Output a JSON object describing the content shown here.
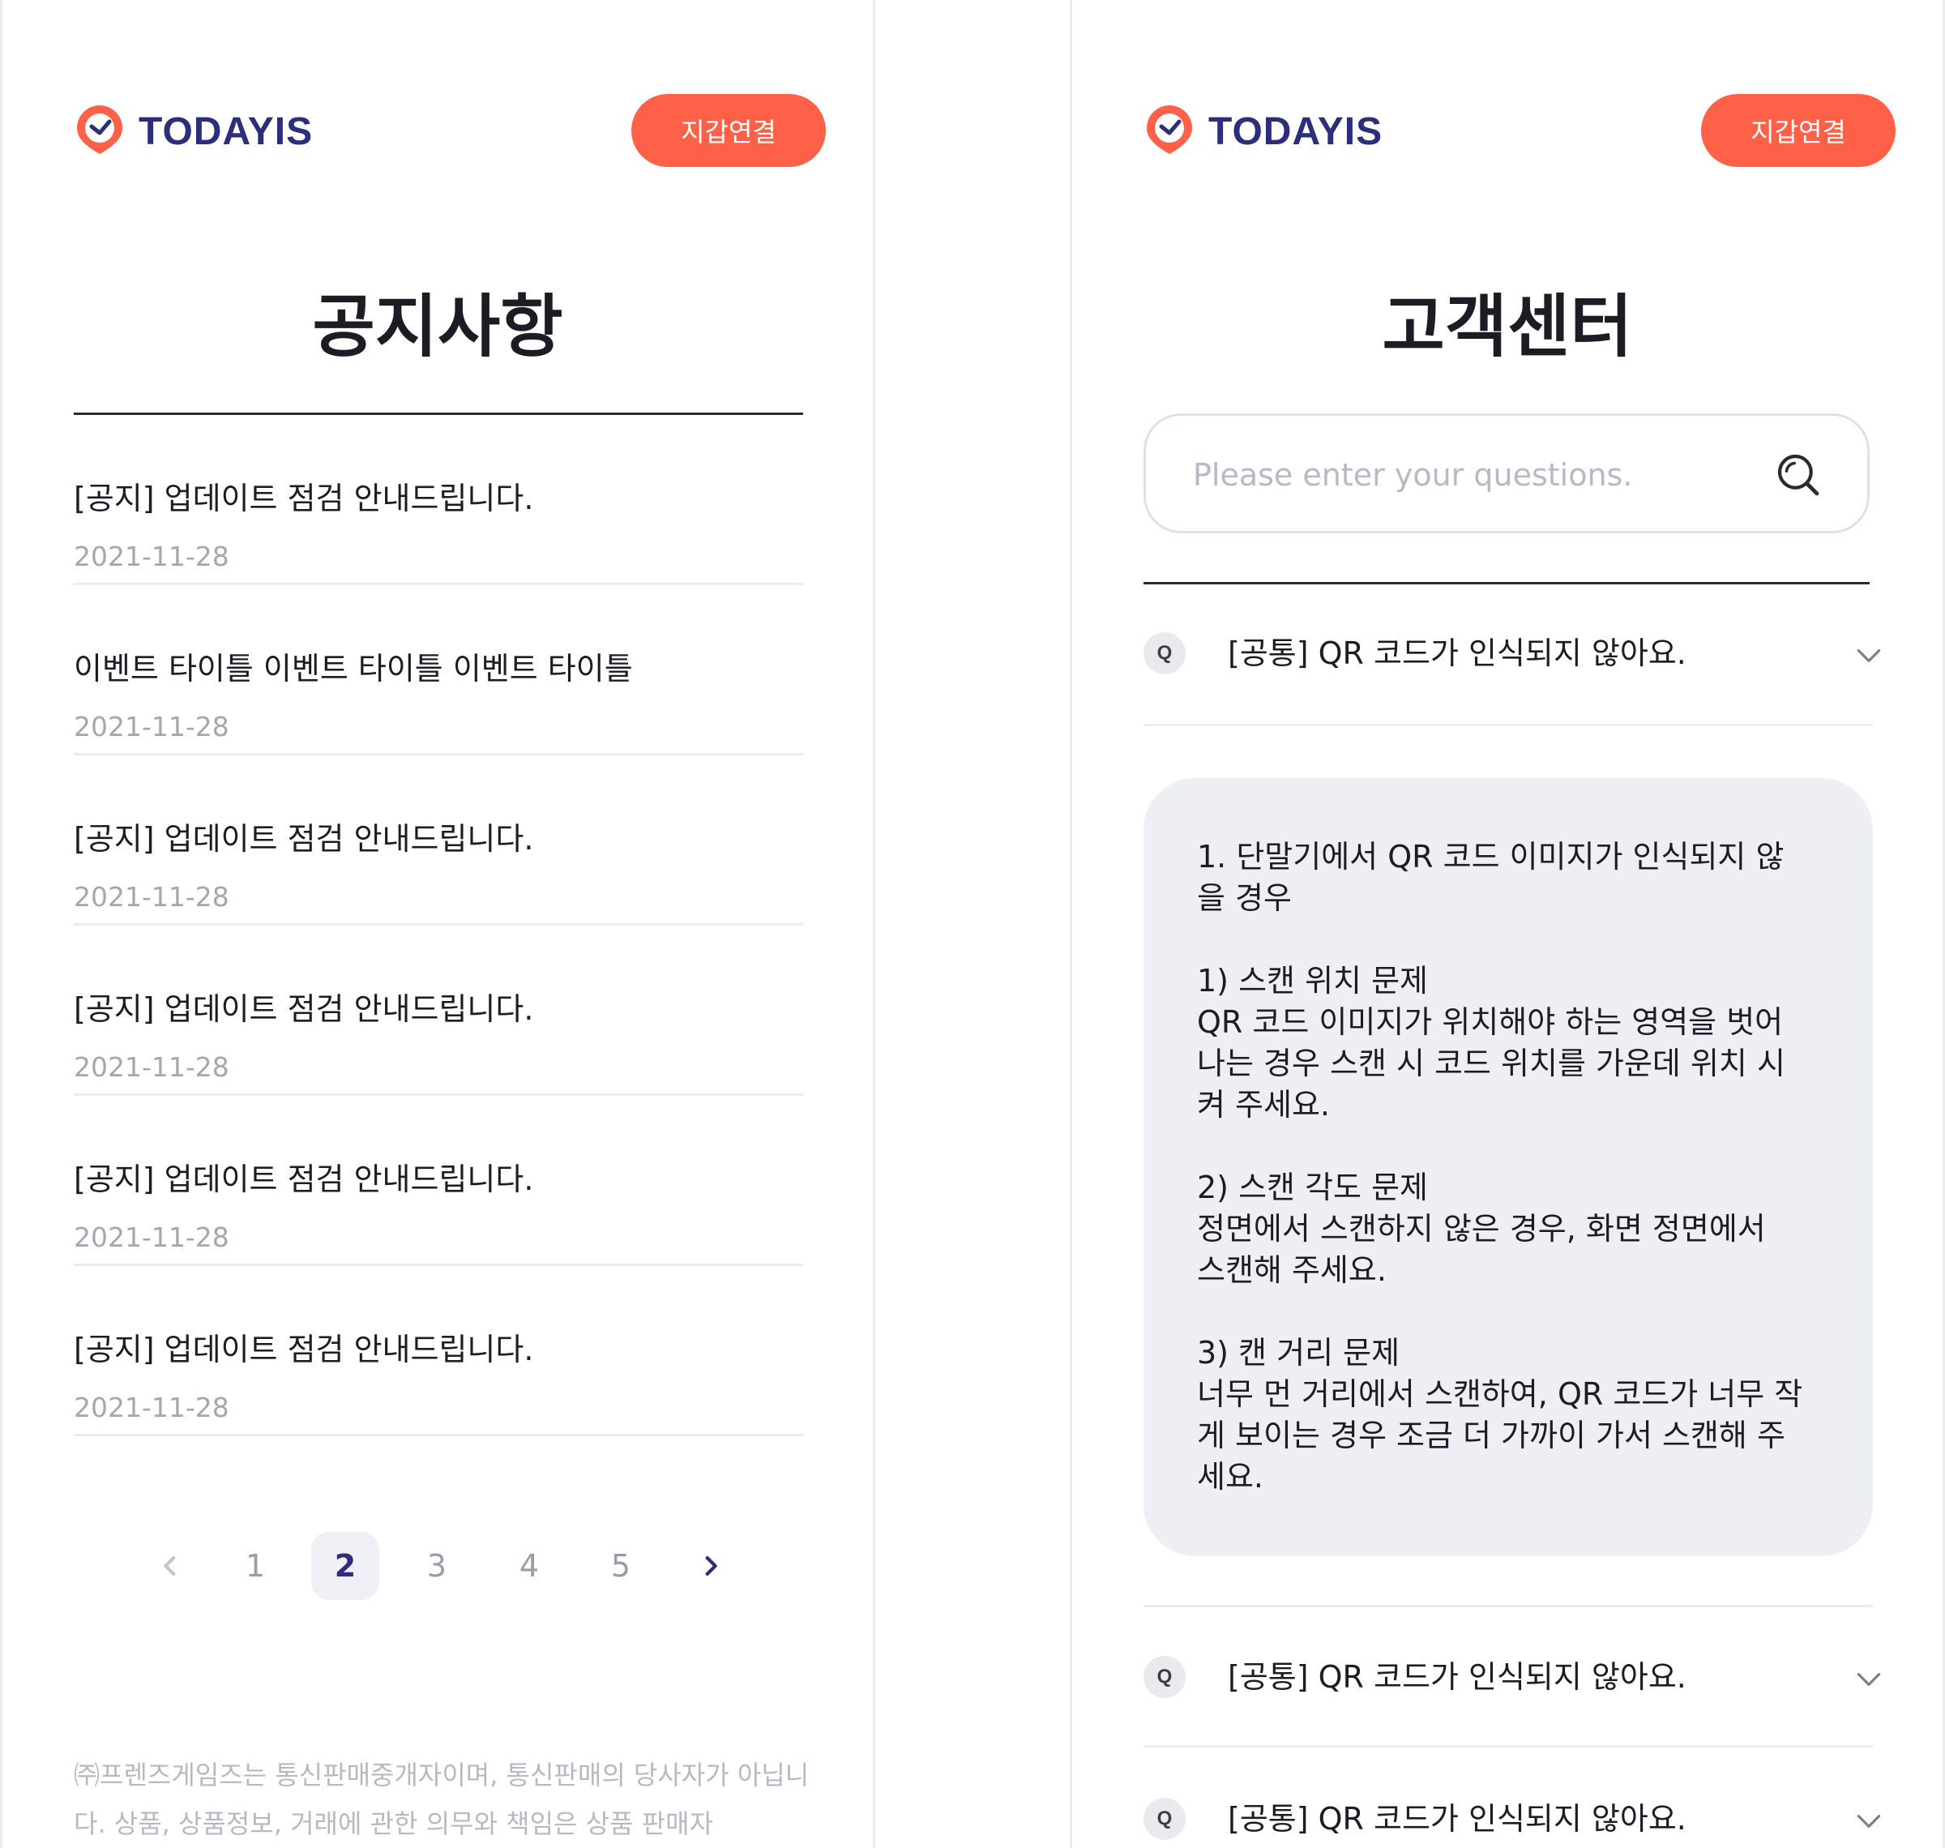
{
  "brand": {
    "name": "TODAYIS",
    "accent": "#ff6148",
    "navy": "#2b2e7a"
  },
  "header": {
    "wallet_button": "지갑연결"
  },
  "notice_page": {
    "title": "공지사항",
    "items": [
      {
        "title": "[공지] 업데이트 점검 안내드립니다.",
        "date": "2021-11-28"
      },
      {
        "title": "이벤트 타이틀 이벤트 타이틀 이벤트 타이틀",
        "date": "2021-11-28"
      },
      {
        "title": "[공지] 업데이트 점검 안내드립니다.",
        "date": "2021-11-28"
      },
      {
        "title": "[공지] 업데이트 점검 안내드립니다.",
        "date": "2021-11-28"
      },
      {
        "title": "[공지] 업데이트 점검 안내드립니다.",
        "date": "2021-11-28"
      },
      {
        "title": "[공지] 업데이트 점검 안내드립니다.",
        "date": "2021-11-28"
      }
    ],
    "pagination": {
      "pages": [
        "1",
        "2",
        "3",
        "4",
        "5"
      ],
      "current": "2"
    },
    "footer": "㈜프렌즈게임즈는 통신판매중개자이며, 통신판매의 당사자가 아닙니다. 상품, 상품정보, 거래에 관한 의무와 책임은 상품 판매자"
  },
  "support_page": {
    "title": "고객센터",
    "search": {
      "placeholder": "Please enter your questions.",
      "value": ""
    },
    "q_badge": "Q",
    "faqs": [
      {
        "question": "[공통] QR 코드가 인식되지 않아요.",
        "expanded": true
      },
      {
        "question": "[공통] QR 코드가 인식되지 않아요.",
        "expanded": false
      },
      {
        "question": "[공통] QR 코드가 인식되지 않아요.",
        "expanded": false
      }
    ],
    "answer": "1. 단말기에서 QR 코드 이미지가 인식되지 않\n을 경우\n\n1) 스캔 위치 문제\nQR 코드 이미지가 위치해야 하는 영역을 벗어\n나는 경우 스캔 시 코드 위치를 가운데 위치 시\n켜 주세요.\n\n2) 스캔 각도 문제\n정면에서 스캔하지 않은 경우, 화면 정면에서\n스캔해 주세요.\n\n3) 캔 거리 문제\n너무 먼 거리에서 스캔하여, QR 코드가 너무 작\n게 보이는 경우 조금 더 가까이 가서 스캔해 주\n세요."
  }
}
